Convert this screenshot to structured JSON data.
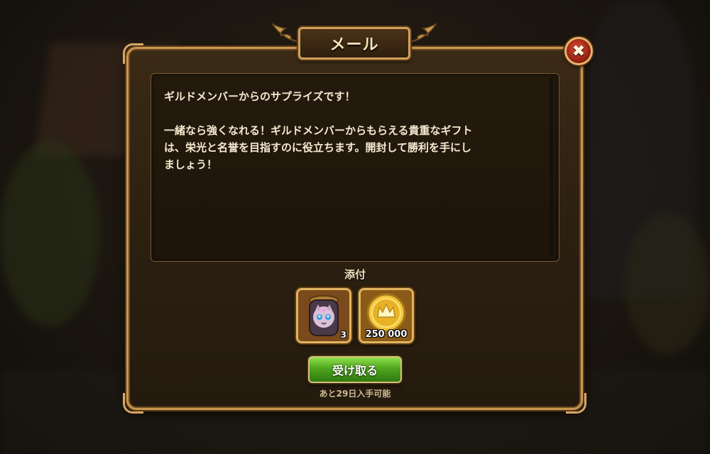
{
  "dialog": {
    "title": "メール",
    "close_icon": "close-x-icon"
  },
  "message": {
    "line1": "ギルドメンバーからのサプライズです！",
    "line2": "一緒なら強くなれる！ギルドメンバーからもらえる貴重なギフト",
    "line3": "は、栄光と名誉を目指すのに役立ちます。開封して勝利を手にし",
    "line4": "ましょう！"
  },
  "attachments": {
    "label": "添付",
    "items": [
      {
        "icon": "pet-jar-icon",
        "quantity": "3"
      },
      {
        "icon": "gold-crown-coin-icon",
        "quantity": "250 000"
      }
    ]
  },
  "actions": {
    "claim_label": "受け取る",
    "expiry_text": "あと29日入手可能"
  },
  "colors": {
    "frame_gold": "#c9964f",
    "claim_green": "#4fa51e",
    "close_red": "#c8301e"
  }
}
